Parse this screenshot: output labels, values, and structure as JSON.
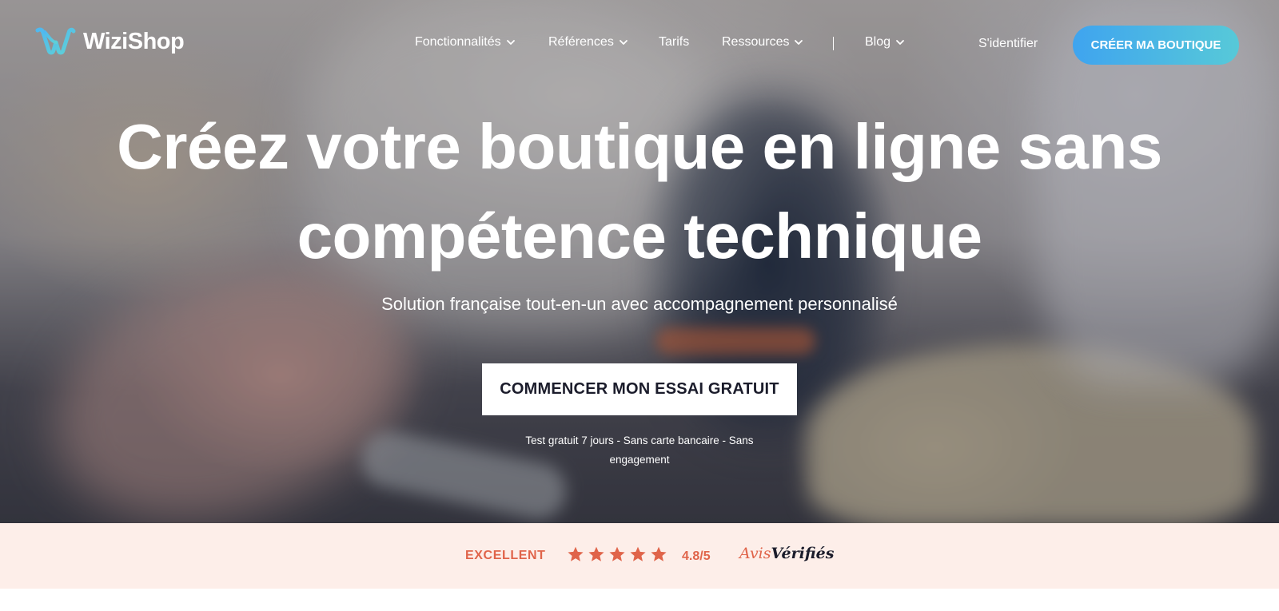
{
  "header": {
    "logo_text": "WiziShop",
    "nav": [
      {
        "label": "Fonctionnalités",
        "has_dropdown": true
      },
      {
        "label": "Références",
        "has_dropdown": true
      },
      {
        "label": "Tarifs",
        "has_dropdown": false
      },
      {
        "label": "Ressources",
        "has_dropdown": true
      },
      {
        "label": "Blog",
        "has_dropdown": true
      }
    ],
    "login_label": "S'identifier",
    "cta_label": "CRÉER MA BOUTIQUE"
  },
  "hero": {
    "title_line1": "Créez votre boutique en ligne sans",
    "title_line2": "compétence technique",
    "subtitle": "Solution française tout-en-un avec accompagnement personnalisé",
    "cta_label": "COMMENCER MON ESSAI GRATUIT",
    "note_line1": "Test gratuit 7 jours - Sans carte bancaire - Sans",
    "note_line2": "engagement"
  },
  "rating": {
    "label": "EXCELLENT",
    "stars": 5,
    "score": "4.8/5",
    "brand_part1": "Avis",
    "brand_part2": "Vérifiés"
  },
  "colors": {
    "accent_blue_start": "#3fa4ef",
    "accent_blue_end": "#57c9d8",
    "rating_orange": "#e0644a",
    "rating_bg": "#fdeee9",
    "dark_text": "#1b1c2b"
  },
  "icons": [
    "wizishop-logo-icon",
    "chevron-down-icon",
    "star-icon"
  ]
}
